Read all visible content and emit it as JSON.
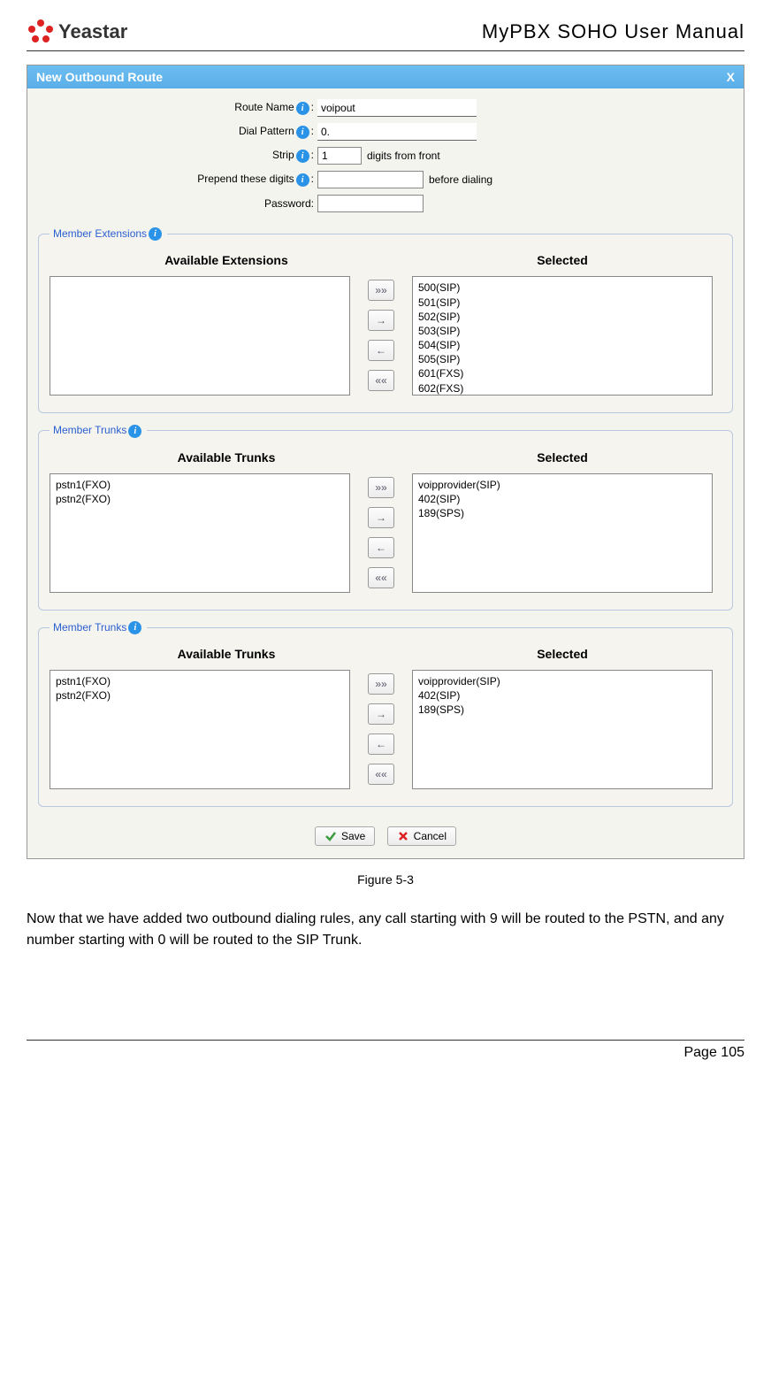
{
  "header": {
    "brand": "Yeastar",
    "doc_title": "MyPBX  SOHO  User  Manual"
  },
  "dialog": {
    "title": "New Outbound Route",
    "close": "X",
    "fields": {
      "route_name": {
        "label": "Route Name",
        "value": "voipout"
      },
      "dial_pattern": {
        "label": "Dial Pattern",
        "value": "0."
      },
      "strip": {
        "label": "Strip",
        "value": "1",
        "suffix": "digits from front"
      },
      "prepend": {
        "label": "Prepend these digits",
        "value": "",
        "suffix": "before dialing"
      },
      "password": {
        "label": "Password:",
        "value": ""
      }
    },
    "sections": [
      {
        "legend": "Member Extensions",
        "left_header": "Available Extensions",
        "right_header": "Selected",
        "available": [],
        "selected": [
          "500(SIP)",
          "501(SIP)",
          "502(SIP)",
          "503(SIP)",
          "504(SIP)",
          "505(SIP)",
          "601(FXS)",
          "602(FXS)"
        ]
      },
      {
        "legend": "Member Trunks",
        "left_header": "Available Trunks",
        "right_header": "Selected",
        "available": [
          "pstn1(FXO)",
          "pstn2(FXO)"
        ],
        "selected": [
          "voipprovider(SIP)",
          "402(SIP)",
          "189(SPS)"
        ]
      },
      {
        "legend": "Member Trunks",
        "left_header": "Available Trunks",
        "right_header": "Selected",
        "available": [
          "pstn1(FXO)",
          "pstn2(FXO)"
        ],
        "selected": [
          "voipprovider(SIP)",
          "402(SIP)",
          "189(SPS)"
        ]
      }
    ],
    "transfer_buttons": {
      "all_right": "»»",
      "right": "→",
      "left": "←",
      "all_left": "««"
    },
    "actions": {
      "save": "Save",
      "cancel": "Cancel"
    }
  },
  "caption": "Figure 5-3",
  "paragraph": "Now that we have added two outbound dialing rules, any call starting with 9 will be routed to the PSTN, and any number starting with 0 will be routed to the SIP Trunk.",
  "footer": {
    "page": "Page 105"
  }
}
